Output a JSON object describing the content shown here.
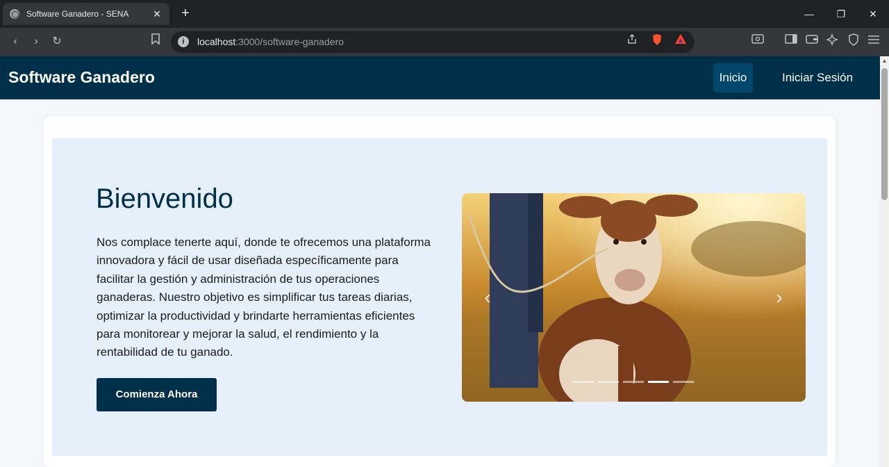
{
  "browser": {
    "tab_title": "Software Ganadero - SENA",
    "tab_close": "✕",
    "new_tab": "+",
    "url_host": "localhost",
    "url_path": ":3000/software-ganadero",
    "minimize": "—",
    "restore": "❐",
    "close": "✕"
  },
  "navbar": {
    "brand": "Software Ganadero",
    "items": [
      {
        "label": "Inicio",
        "active": true
      },
      {
        "label": "Iniciar Sesión",
        "active": false
      }
    ]
  },
  "hero": {
    "heading": "Bienvenido",
    "paragraph": "Nos complace tenerte aquí, donde te ofrecemos una plataforma innovadora y fácil de usar diseñada específicamente para facilitar la gestión y administración de tus operaciones ganaderas. Nuestro objetivo es simplificar tus tareas diarias, optimizar la productividad y brindarte herramientas eficientes para monitorear y mejorar la salud, el rendimiento y la rentabilidad de tu ganado.",
    "cta_label": "Comienza Ahora"
  },
  "carousel": {
    "slide_count": 5,
    "active_index": 3,
    "prev_glyph": "‹",
    "next_glyph": "›"
  },
  "colors": {
    "primary": "#003049",
    "nav_active": "#01476b",
    "hero_bg": "#e6f0fa"
  }
}
